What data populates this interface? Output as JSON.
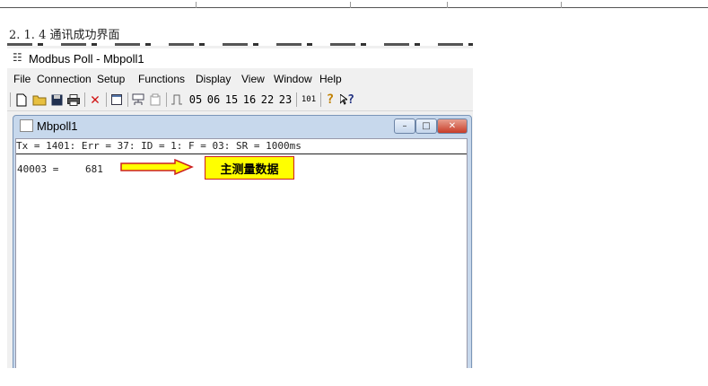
{
  "heading": "2. 1. 4 通讯成功界面",
  "app": {
    "icon": "modbus-app-icon",
    "title": "Modbus Poll - Mbpoll1"
  },
  "menu": [
    "File",
    "Connection",
    "Setup",
    "Functions",
    "Display",
    "View",
    "Window",
    "Help"
  ],
  "toolbar": {
    "function_codes": [
      "05",
      "06",
      "15",
      "16",
      "22",
      "23"
    ],
    "reg_button": "101",
    "help_icon": "?",
    "context_help": "?"
  },
  "mdi": {
    "title": "Mbpoll1",
    "status_line": "Tx = 1401: Err = 37: ID = 1: F = 03: SR = 1000ms",
    "register": "40003 =",
    "value": "681"
  },
  "annotation": {
    "label": "主测量数据",
    "arrow_color": "#ffff00",
    "border_color": "#cc2020"
  }
}
